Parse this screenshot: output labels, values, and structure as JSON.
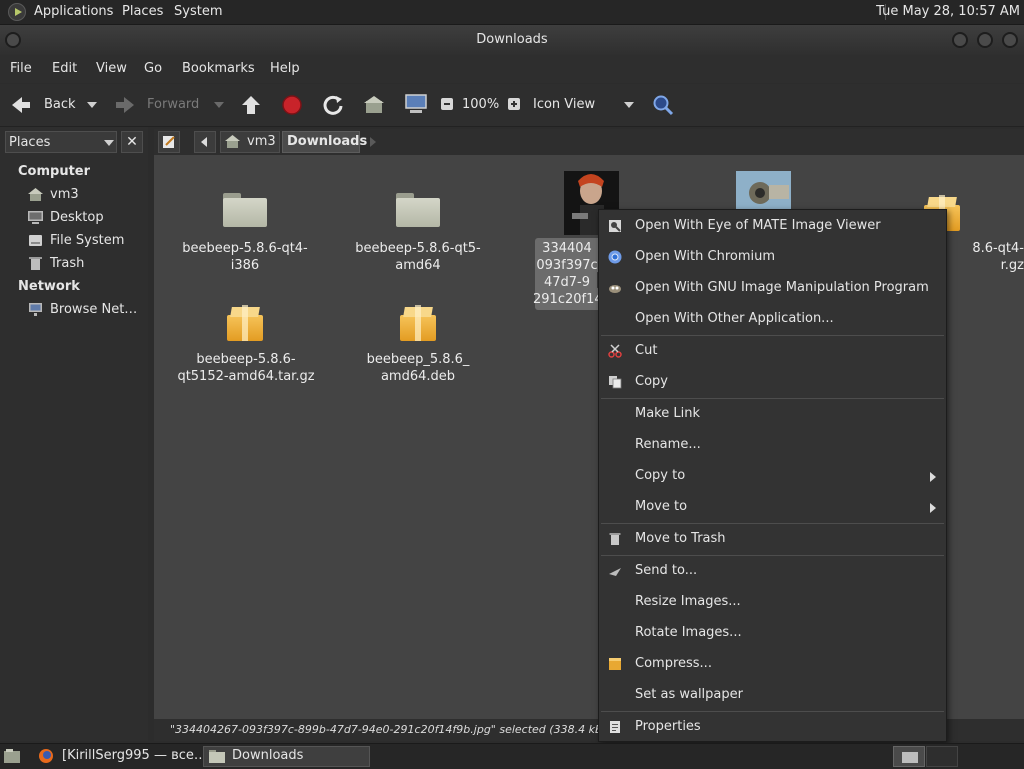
{
  "top_panel": {
    "menus": [
      "Applications",
      "Places",
      "System"
    ],
    "clock": "Tue May 28, 10:57 AM"
  },
  "window": {
    "title": "Downloads"
  },
  "menubar": [
    "File",
    "Edit",
    "View",
    "Go",
    "Bookmarks",
    "Help"
  ],
  "toolbar": {
    "back": "Back",
    "forward": "Forward",
    "zoom": "100%",
    "view_mode": "Icon View"
  },
  "sidebar": {
    "combo_label": "Places",
    "close": "✕",
    "sections": [
      {
        "title": "Computer",
        "items": [
          "vm3",
          "Desktop",
          "File System",
          "Trash"
        ]
      },
      {
        "title": "Network",
        "items": [
          "Browse Net…"
        ]
      }
    ]
  },
  "pathbar": {
    "crumbs": [
      "vm3",
      "Downloads"
    ]
  },
  "files": [
    {
      "name": "beebeep-5.8.6-qt4-\ni386",
      "kind": "folder"
    },
    {
      "name": "beebeep-5.8.6-qt5-\namd64",
      "kind": "folder"
    },
    {
      "name": "334404\n093f397c\n47d7-9\n291c20f14",
      "kind": "image-selected"
    },
    {
      "name": "",
      "kind": "image"
    },
    {
      "name": "8.6-qt4-\nr.gz",
      "kind": "package"
    },
    {
      "name": "beebeep-5.8.6-\nqt5152-amd64.tar.gz",
      "kind": "package"
    },
    {
      "name": "beebeep_5.8.6_\namd64.deb",
      "kind": "package"
    }
  ],
  "status": "\"334404267-093f397c-899b-47d7-94e0-291c20f14f9b.jpg\" selected (338.4 kB), Free sp",
  "context_menu": {
    "groups": [
      [
        {
          "label": "Open With Eye of MATE Image Viewer",
          "icon": "eye-of-mate-icon"
        },
        {
          "label": "Open With Chromium",
          "icon": "chromium-icon"
        },
        {
          "label": "Open With GNU Image Manipulation Program",
          "icon": "gimp-icon"
        },
        {
          "label": "Open With Other Application...",
          "icon": ""
        }
      ],
      [
        {
          "label": "Cut",
          "icon": "scissors-icon"
        },
        {
          "label": "Copy",
          "icon": "copy-icon"
        }
      ],
      [
        {
          "label": "Make Link",
          "icon": ""
        },
        {
          "label": "Rename...",
          "icon": ""
        },
        {
          "label": "Copy to",
          "icon": "",
          "submenu": true
        },
        {
          "label": "Move to",
          "icon": "",
          "submenu": true
        }
      ],
      [
        {
          "label": "Move to Trash",
          "icon": "trash-icon"
        }
      ],
      [
        {
          "label": "Send to...",
          "icon": "send-icon"
        },
        {
          "label": "Resize Images...",
          "icon": ""
        },
        {
          "label": "Rotate Images...",
          "icon": ""
        },
        {
          "label": "Compress...",
          "icon": "archive-icon"
        },
        {
          "label": "Set as wallpaper",
          "icon": ""
        }
      ],
      [
        {
          "label": "Properties",
          "icon": "properties-icon"
        }
      ]
    ]
  },
  "taskbar": {
    "items": [
      "[KirillSerg995 — все…",
      "Downloads"
    ]
  }
}
